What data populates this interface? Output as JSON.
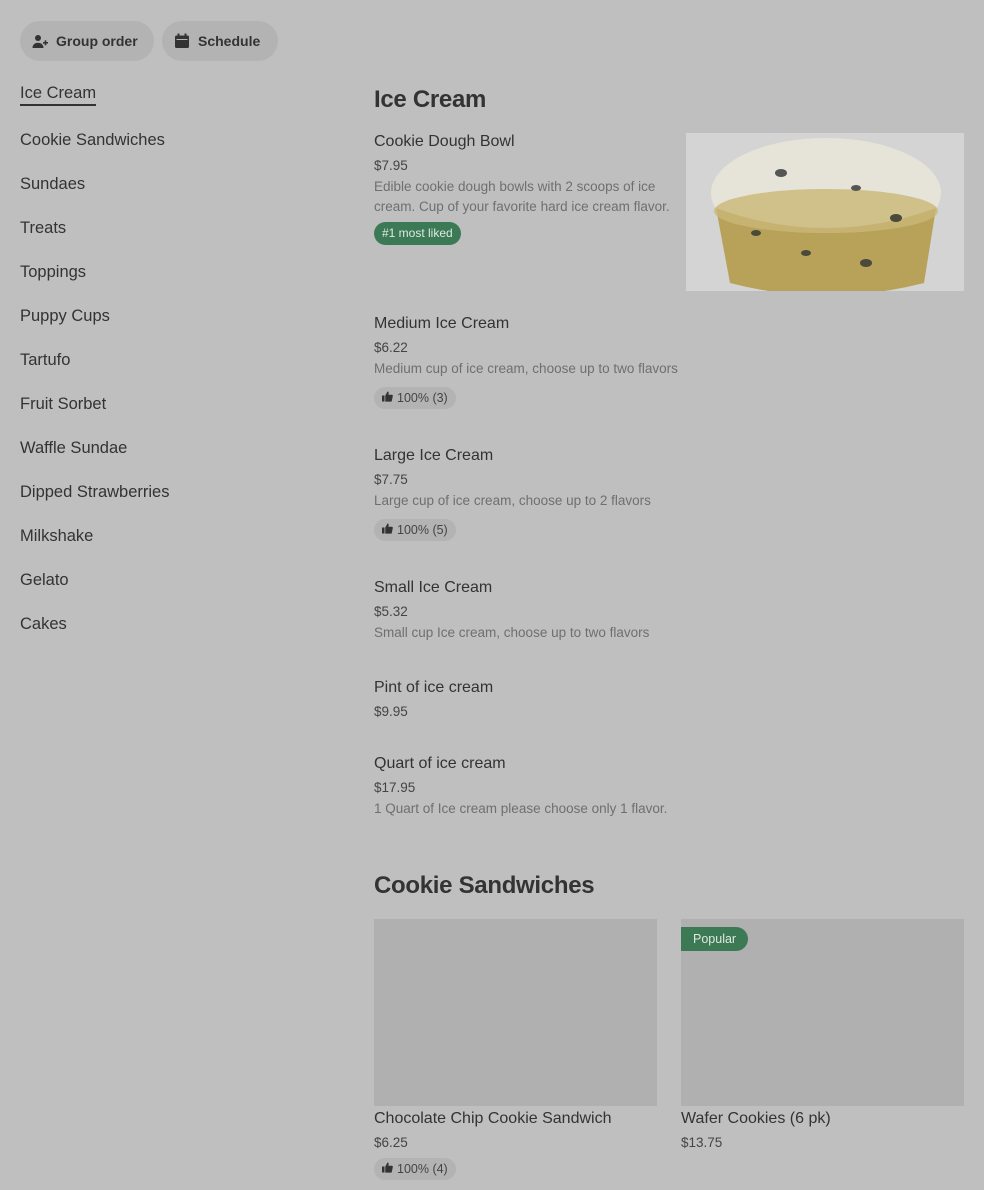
{
  "toolbar": {
    "group_order_label": "Group order",
    "schedule_label": "Schedule",
    "group_order_icon": "add-person-icon",
    "schedule_icon": "calendar-icon"
  },
  "sidebar": {
    "items": [
      {
        "label": "Ice Cream",
        "active": true
      },
      {
        "label": "Cookie Sandwiches"
      },
      {
        "label": "Sundaes"
      },
      {
        "label": "Treats"
      },
      {
        "label": "Toppings"
      },
      {
        "label": "Puppy Cups"
      },
      {
        "label": "Tartufo"
      },
      {
        "label": "Fruit Sorbet"
      },
      {
        "label": "Waffle Sundae"
      },
      {
        "label": "Dipped Strawberries"
      },
      {
        "label": "Milkshake"
      },
      {
        "label": "Gelato"
      },
      {
        "label": "Cakes"
      }
    ]
  },
  "sections": {
    "ice_cream": {
      "title": "Ice Cream",
      "items": [
        {
          "name": "Cookie Dough Bowl",
          "price": "$7.95",
          "description": "Edible cookie dough bowls with 2 scoops of ice cream. Cup of your favorite hard ice cream flavor.",
          "badge": "#1 most liked"
        },
        {
          "name": "Medium Ice Cream",
          "price": "$6.22",
          "description": "Medium cup of ice cream, choose up to two flavors",
          "rating": "100% (3)"
        },
        {
          "name": "Large Ice Cream",
          "price": "$7.75",
          "description": "Large cup of ice cream, choose up to 2 flavors",
          "rating": "100% (5)"
        },
        {
          "name": "Small Ice Cream",
          "price": "$5.32",
          "description": "Small cup Ice cream, choose up to two flavors"
        },
        {
          "name": "Pint of ice cream",
          "price": "$9.95"
        },
        {
          "name": "Quart of ice cream",
          "price": "$17.95",
          "description": "1 Quart of Ice cream please choose only 1 flavor."
        }
      ]
    },
    "cookie_sandwiches": {
      "title": "Cookie Sandwiches",
      "items": [
        {
          "name": "Chocolate Chip Cookie Sandwich",
          "price": "$6.25",
          "rating": "100% (4)"
        },
        {
          "name": "Wafer Cookies (6 pk)",
          "price": "$13.75",
          "badge": "Popular"
        }
      ]
    }
  },
  "colors": {
    "background": "#bfbfbf",
    "pill": "#b3b3b3",
    "badge_green": "#3c7a55",
    "text": "#333333"
  },
  "icons": {
    "rating": "thumbs-up-icon"
  }
}
